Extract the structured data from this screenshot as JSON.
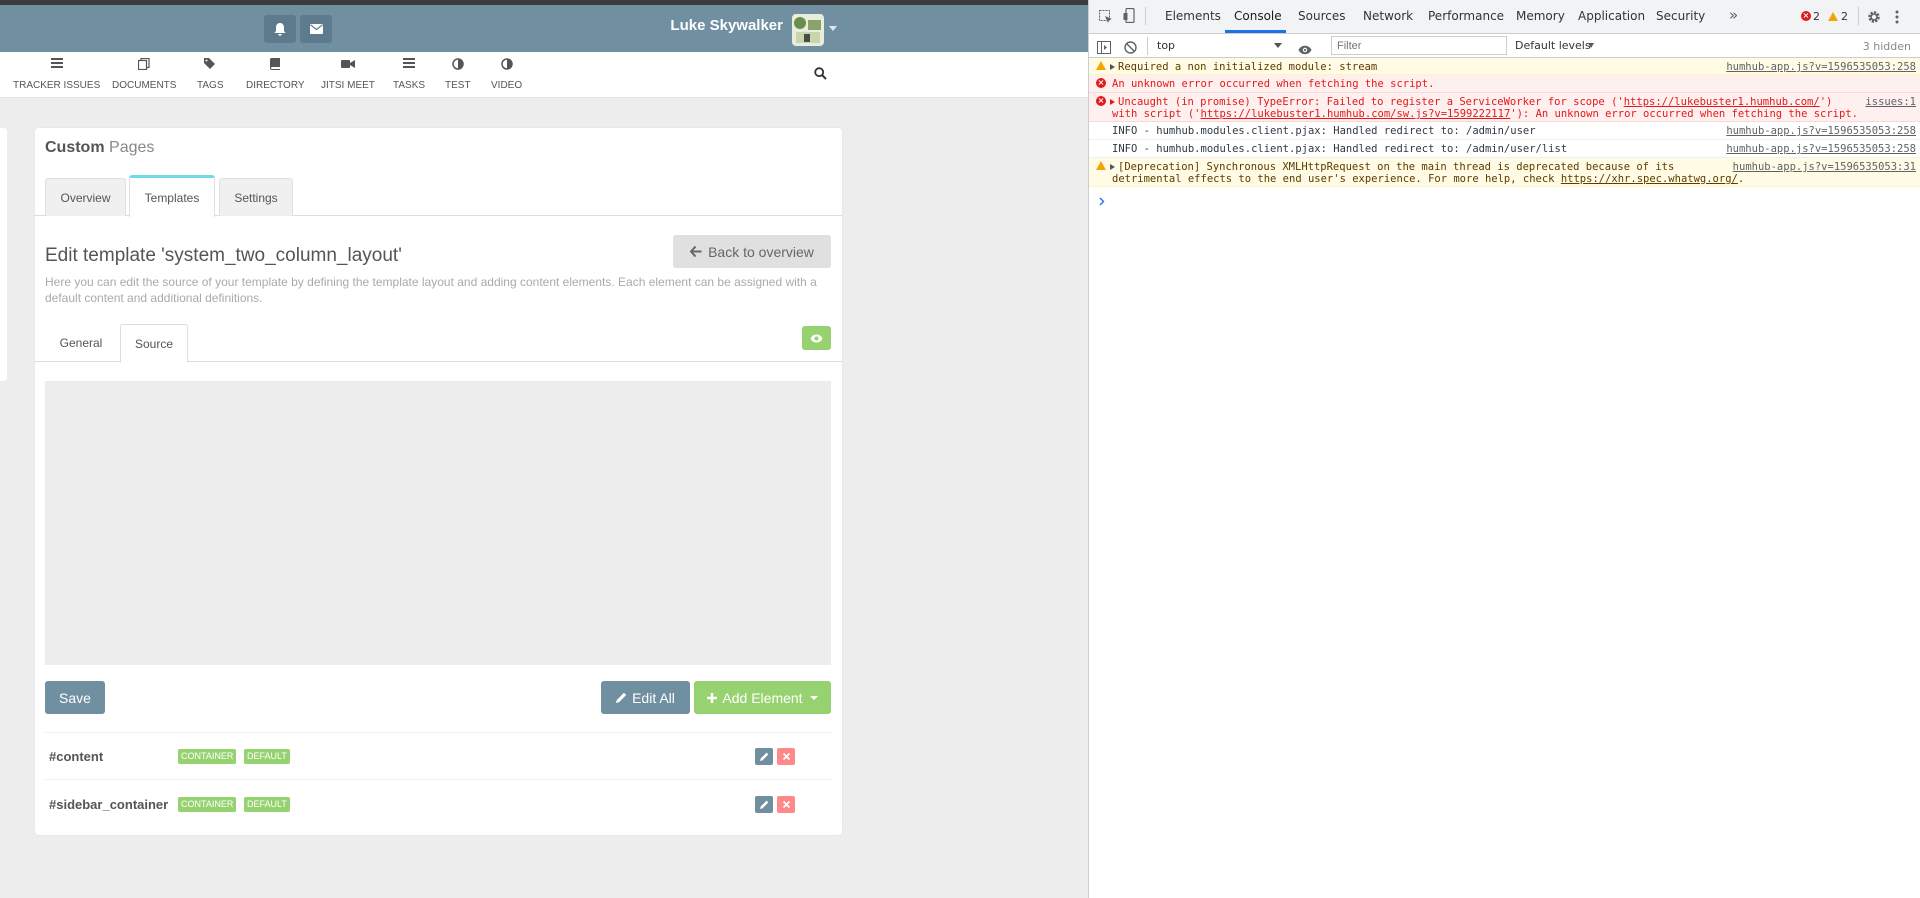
{
  "topbar": {
    "user_name": "Luke Skywalker",
    "notifications_icon": "bell-icon",
    "messages_icon": "envelope-icon"
  },
  "nav": {
    "items": [
      {
        "label": "TRACKER ISSUES",
        "icon": "tracker-icon"
      },
      {
        "label": "DOCUMENTS",
        "icon": "documents-icon"
      },
      {
        "label": "TAGS",
        "icon": "tags-icon"
      },
      {
        "label": "DIRECTORY",
        "icon": "book-icon"
      },
      {
        "label": "JITSI MEET",
        "icon": "video-camera-icon"
      },
      {
        "label": "TASKS",
        "icon": "tasks-icon"
      },
      {
        "label": "TEST",
        "icon": "half-circle-icon"
      },
      {
        "label": "VIDEO",
        "icon": "half-circle-icon"
      }
    ]
  },
  "panel": {
    "title_bold": "Custom",
    "title_light": "Pages",
    "tabs": [
      "Overview",
      "Templates",
      "Settings"
    ],
    "active_tab": "Templates",
    "edit_title": "Edit template 'system_two_column_layout'",
    "description": "Here you can edit the source of your template by defining the template layout and adding content elements. Each element can be assigned with a default content and additional definitions.",
    "back_button": "Back to overview",
    "subtabs": [
      "General",
      "Source"
    ],
    "active_subtab": "Source",
    "save_button": "Save",
    "edit_all_button": "Edit All",
    "add_element_button": "Add Element",
    "elements": [
      {
        "name": "#content",
        "badges": [
          "CONTAINER",
          "DEFAULT"
        ]
      },
      {
        "name": "#sidebar_container",
        "badges": [
          "CONTAINER",
          "DEFAULT"
        ]
      }
    ]
  },
  "devtools": {
    "tabs": [
      "Elements",
      "Console",
      "Sources",
      "Network",
      "Performance",
      "Memory",
      "Application",
      "Security"
    ],
    "active_tab": "Console",
    "more_tabs": "»",
    "error_count": "2",
    "warning_count": "2",
    "context": "top",
    "filter_placeholder": "Filter",
    "levels": "Default levels",
    "hidden": "3 hidden",
    "logs": [
      {
        "level": "warn",
        "text": "Required a non initialized module: stream",
        "source": "humhub-app.js?v=1596535053:258"
      },
      {
        "level": "err",
        "text": "An unknown error occurred when fetching the script.",
        "source": ""
      },
      {
        "level": "err",
        "line1_a": "Uncaught (in promise) TypeError: Failed to register a ServiceWorker for scope ('",
        "line1_link": "https://lukebuster1.humhub.com/",
        "line1_b": "')",
        "line2_a": "with script ('",
        "line2_link": "https://lukebuster1.humhub.com/sw.js?v=1599222117",
        "line2_b": "'): An unknown error occurred when fetching the script.",
        "source": "issues:1"
      },
      {
        "level": "info",
        "text": "INFO - humhub.modules.client.pjax: Handled redirect to: /admin/user",
        "source": "humhub-app.js?v=1596535053:258"
      },
      {
        "level": "info",
        "text": "INFO - humhub.modules.client.pjax: Handled redirect to: /admin/user/list",
        "source": "humhub-app.js?v=1596535053:258"
      },
      {
        "level": "warn",
        "line1": "[Deprecation] Synchronous XMLHttpRequest on the main thread is deprecated because of its",
        "line2_a": "detrimental effects to the end user's experience. For more help, check ",
        "line2_link": "https://xhr.spec.whatwg.org/",
        "line2_b": ".",
        "source": "humhub-app.js?v=1596535053:31"
      }
    ]
  }
}
